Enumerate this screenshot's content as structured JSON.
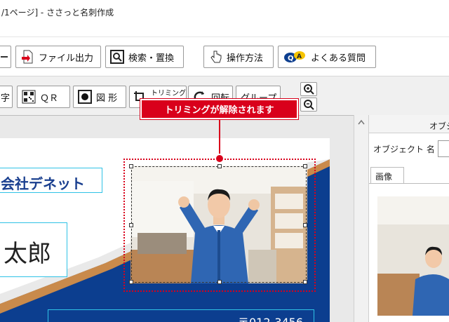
{
  "window": {
    "title": "/1ページ] - ささっと名刺作成"
  },
  "toolbar1": {
    "buttons": [
      {
        "label": "",
        "icon": "minus-icon"
      },
      {
        "label": "ファイル出力",
        "icon": "file-export-icon"
      },
      {
        "label": "検索・置換",
        "icon": "search-replace-icon"
      },
      {
        "label": "操作方法",
        "icon": "pointer-hand-icon"
      },
      {
        "label": "よくある質問",
        "icon": "faq-qa-icon"
      }
    ]
  },
  "toolbar2": {
    "buttons": [
      {
        "label": "字",
        "icon": ""
      },
      {
        "label": "ＱＲ",
        "icon": "qr-code-icon"
      },
      {
        "label": "図 形",
        "icon": "shape-icon"
      },
      {
        "label": "トリミング",
        "icon": "trim-icon"
      },
      {
        "label": "回転",
        "icon": "rotate-icon"
      },
      {
        "label": "グループ",
        "icon": "group-icon"
      }
    ],
    "zoom_in": "zoom-in-icon",
    "zoom_out": "zoom-out-icon"
  },
  "callout": {
    "text": "トリミングが解除されます"
  },
  "card": {
    "company": "会社デネット",
    "name": "太郎",
    "phone": "〒012-3456"
  },
  "panel": {
    "header": "オブジ",
    "object_name_label": "オブジェクト 名",
    "tab_label": "画像"
  },
  "colors": {
    "accent": "#d9001b",
    "card_blue": "#0c3e8f",
    "text_blue": "#1a3f8f"
  }
}
